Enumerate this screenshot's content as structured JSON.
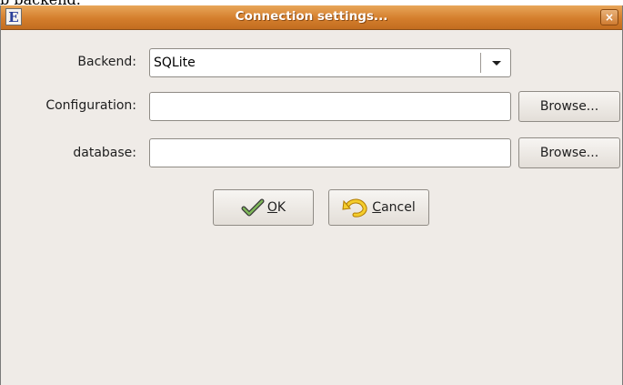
{
  "background_text": "b backend.",
  "window": {
    "title": "Connection settings...",
    "app_icon_letter": "E",
    "close_glyph": "×"
  },
  "form": {
    "backend_label": "Backend:",
    "backend_value": "SQLite",
    "configuration_label": "Configuration:",
    "configuration_value": "",
    "database_label": "database:",
    "database_value": ""
  },
  "buttons": {
    "browse_1": "Browse...",
    "browse_2": "Browse...",
    "ok_mnemonic": "O",
    "ok_rest": "K",
    "cancel_mnemonic": "C",
    "cancel_rest": "ancel"
  },
  "colors": {
    "titlebar": "#d47e2c",
    "window_bg": "#efebe7",
    "app_icon_letter": "#2a3f99"
  },
  "icons": {
    "ok": "checkmark-arrow-icon",
    "cancel": "undo-arrow-icon",
    "combo": "chevron-down-icon",
    "close": "close-icon"
  }
}
